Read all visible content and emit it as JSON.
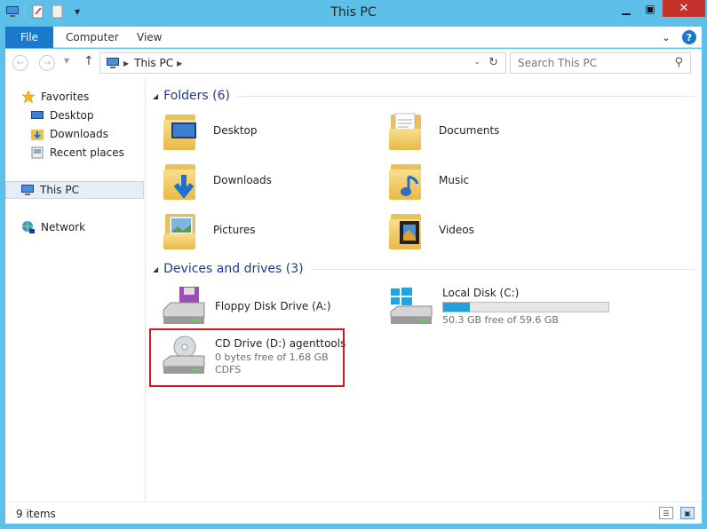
{
  "window": {
    "title": "This PC"
  },
  "ribbon": {
    "tabs": [
      "File",
      "Computer",
      "View"
    ]
  },
  "address": {
    "crumb": "This PC",
    "search_placeholder": "Search This PC"
  },
  "nav_pane": {
    "favorites": "Favorites",
    "items": [
      "Desktop",
      "Downloads",
      "Recent places"
    ],
    "this_pc": "This PC",
    "network": "Network"
  },
  "folders": {
    "header": "Folders (6)",
    "items": [
      "Desktop",
      "Documents",
      "Downloads",
      "Music",
      "Pictures",
      "Videos"
    ]
  },
  "drives": {
    "header": "Devices and drives (3)",
    "floppy": {
      "name": "Floppy Disk Drive (A:)"
    },
    "local": {
      "name": "Local Disk (C:)",
      "free": "50.3 GB free of 59.6 GB",
      "used_fraction": 0.16
    },
    "cd": {
      "name": "CD Drive (D:) agenttools",
      "free": "0 bytes free of 1.68 GB",
      "fs": "CDFS"
    }
  },
  "status": {
    "count": "9 items"
  },
  "colors": {
    "accent": "#1979ca",
    "frame": "#5cc0e8",
    "highlight": "#d9121b",
    "bar": "#26a0da"
  }
}
